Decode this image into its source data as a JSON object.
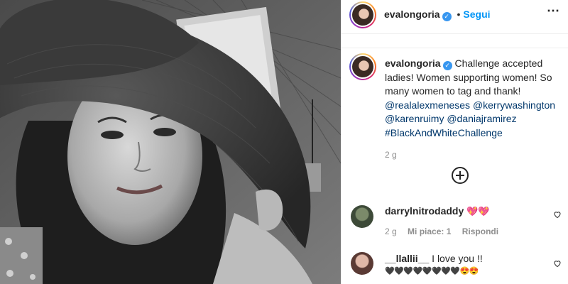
{
  "header": {
    "username": "evalongoria",
    "follow_label": "Segui",
    "separator": "•",
    "avatar_icon": "profile-avatar"
  },
  "caption": {
    "username": "evalongoria",
    "line1": "Challenge accepted",
    "line2": "ladies! Women supporting women! So",
    "line3": "many women to tag and thank!",
    "tag1": "@realalexmeneses",
    "tag2": "@kerrywashington",
    "tag3": "@karenruimy",
    "tag4": "@daniajramirez",
    "hashtag": "#BlackAndWhiteChallenge",
    "time": "2 g"
  },
  "load_more_icon": "plus-circle-icon",
  "comments": [
    {
      "username": "darrylnitrodaddy",
      "text": "💖💖",
      "time": "2 g",
      "likes": "Mi piace: 1",
      "reply_label": "Rispondi"
    },
    {
      "username": "__llallii__",
      "text": "I love you !!",
      "text2": "🖤🖤🖤🖤🖤🖤🖤🖤😍😍"
    }
  ],
  "colors": {
    "accent": "#0095f6",
    "verified": "#3897f0",
    "muted": "#8e8e8e",
    "link": "#00376b"
  }
}
